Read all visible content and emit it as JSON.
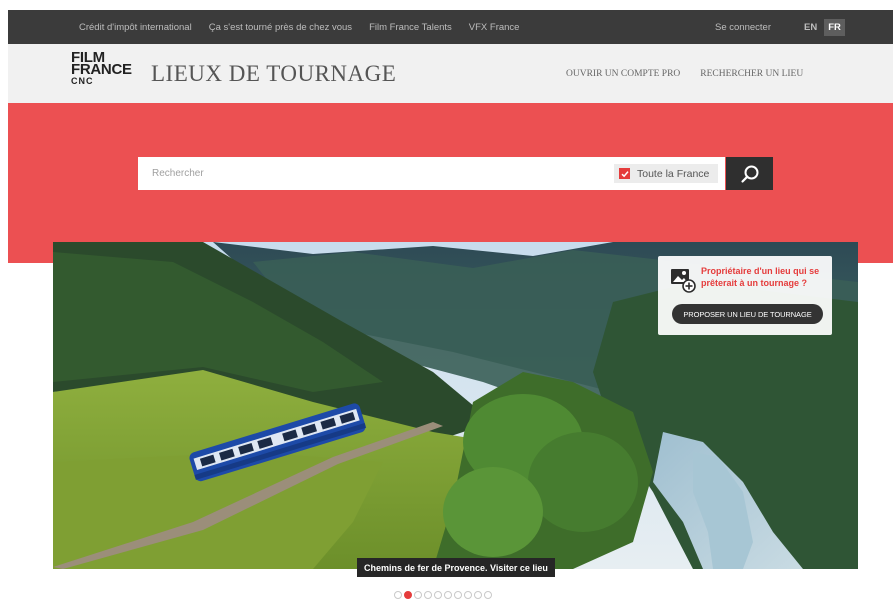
{
  "topbar": {
    "links": [
      "Crédit d'impôt international",
      "Ça s'est tourné près de chez vous",
      "Film France Talents",
      "VFX France"
    ],
    "login": "Se connecter",
    "lang_en": "EN",
    "lang_fr": "FR",
    "active_lang": "FR"
  },
  "header": {
    "logo": {
      "line1": "FILM",
      "line2": "FRANCE",
      "line3": "CNC"
    },
    "title": "LIEUX DE TOURNAGE",
    "nav": [
      "OUVRIR UN COMPTE PRO",
      "RECHERCHER UN LIEU"
    ]
  },
  "search": {
    "placeholder": "Rechercher",
    "value": "",
    "scope_label": "Toute la France",
    "scope_checked": true
  },
  "promo": {
    "text": "Propriétaire d'un lieu qui se prêterait à un tournage ?",
    "button": "PROPOSER UN LIEU DE TOURNAGE"
  },
  "hero": {
    "caption": "Chemins de fer de Provence. Visiter ce lieu"
  },
  "carousel": {
    "total": 10,
    "active": 1
  },
  "colors": {
    "accent": "#ec5052",
    "dark": "#3b3b3b",
    "check": "#e53c3c"
  },
  "icons": [
    "search-icon",
    "check-icon",
    "image-add-icon"
  ]
}
